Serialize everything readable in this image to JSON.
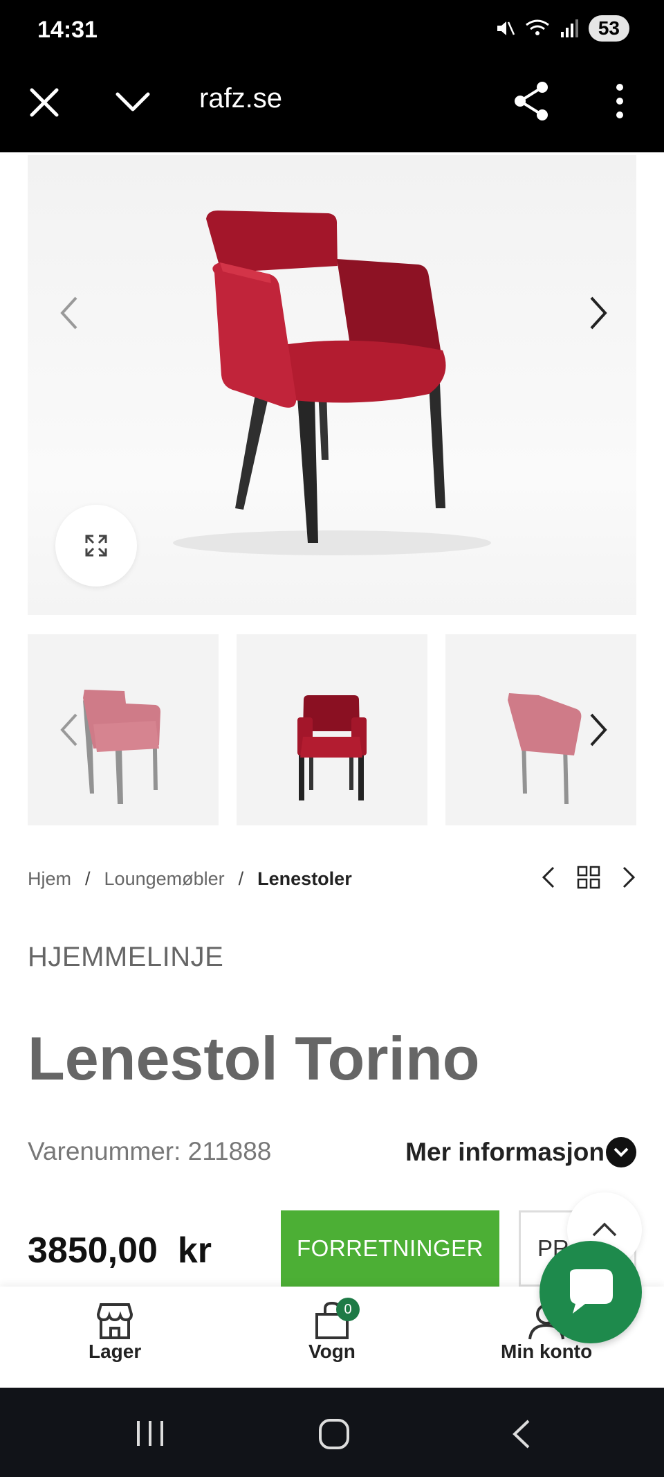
{
  "status_bar": {
    "time": "14:31",
    "battery": "53"
  },
  "browser": {
    "url": "rafz.se"
  },
  "breadcrumb": {
    "items": [
      "Hjem",
      "Loungemøbler",
      "Lenestoler"
    ],
    "separator": "/"
  },
  "product": {
    "brand": "HJEMMELINJE",
    "title": "Lenestol Torino",
    "sku": "Varenummer: 211888",
    "more_info": "Mer informasjon",
    "price": "3850,00  kr",
    "primary_button": "FORRETNINGER",
    "secondary_button": "PRI"
  },
  "bottom_nav": {
    "items": [
      {
        "label": "Lager",
        "icon": "store-icon"
      },
      {
        "label": "Vogn",
        "icon": "bag-icon",
        "badge": "0"
      },
      {
        "label": "Min konto",
        "icon": "user-icon"
      }
    ]
  },
  "colors": {
    "accent_green": "#4caf35",
    "chat_green": "#1e8a4c",
    "chair_red": "#a3162a"
  }
}
